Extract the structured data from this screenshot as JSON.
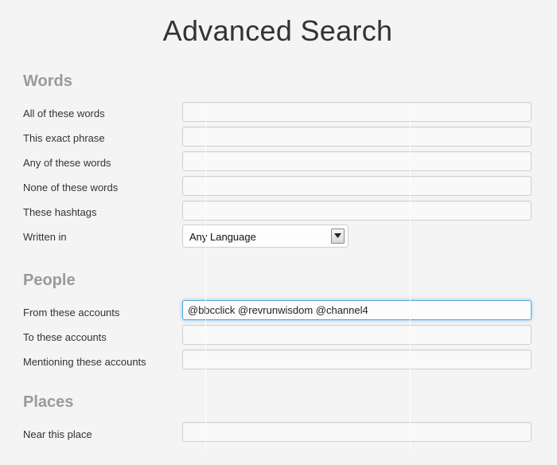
{
  "page": {
    "title": "Advanced Search"
  },
  "sections": {
    "words": {
      "heading": "Words",
      "all_label": "All of these words",
      "all_value": "",
      "exact_label": "This exact phrase",
      "exact_value": "",
      "any_label": "Any of these words",
      "any_value": "",
      "none_label": "None of these words",
      "none_value": "",
      "hashtags_label": "These hashtags",
      "hashtags_value": "",
      "language_label": "Written in",
      "language_value": "Any Language"
    },
    "people": {
      "heading": "People",
      "from_label": "From these accounts",
      "from_value": "@bbcclick @revrunwisdom @channel4",
      "to_label": "To these accounts",
      "to_value": "",
      "mentioning_label": "Mentioning these accounts",
      "mentioning_value": ""
    },
    "places": {
      "heading": "Places",
      "near_label": "Near this place",
      "near_value": ""
    }
  },
  "icons": {
    "select_arrow": "chevron-down-icon"
  },
  "colors": {
    "focus_border": "#56a8e0",
    "section_heading": "#9a9a9a"
  }
}
